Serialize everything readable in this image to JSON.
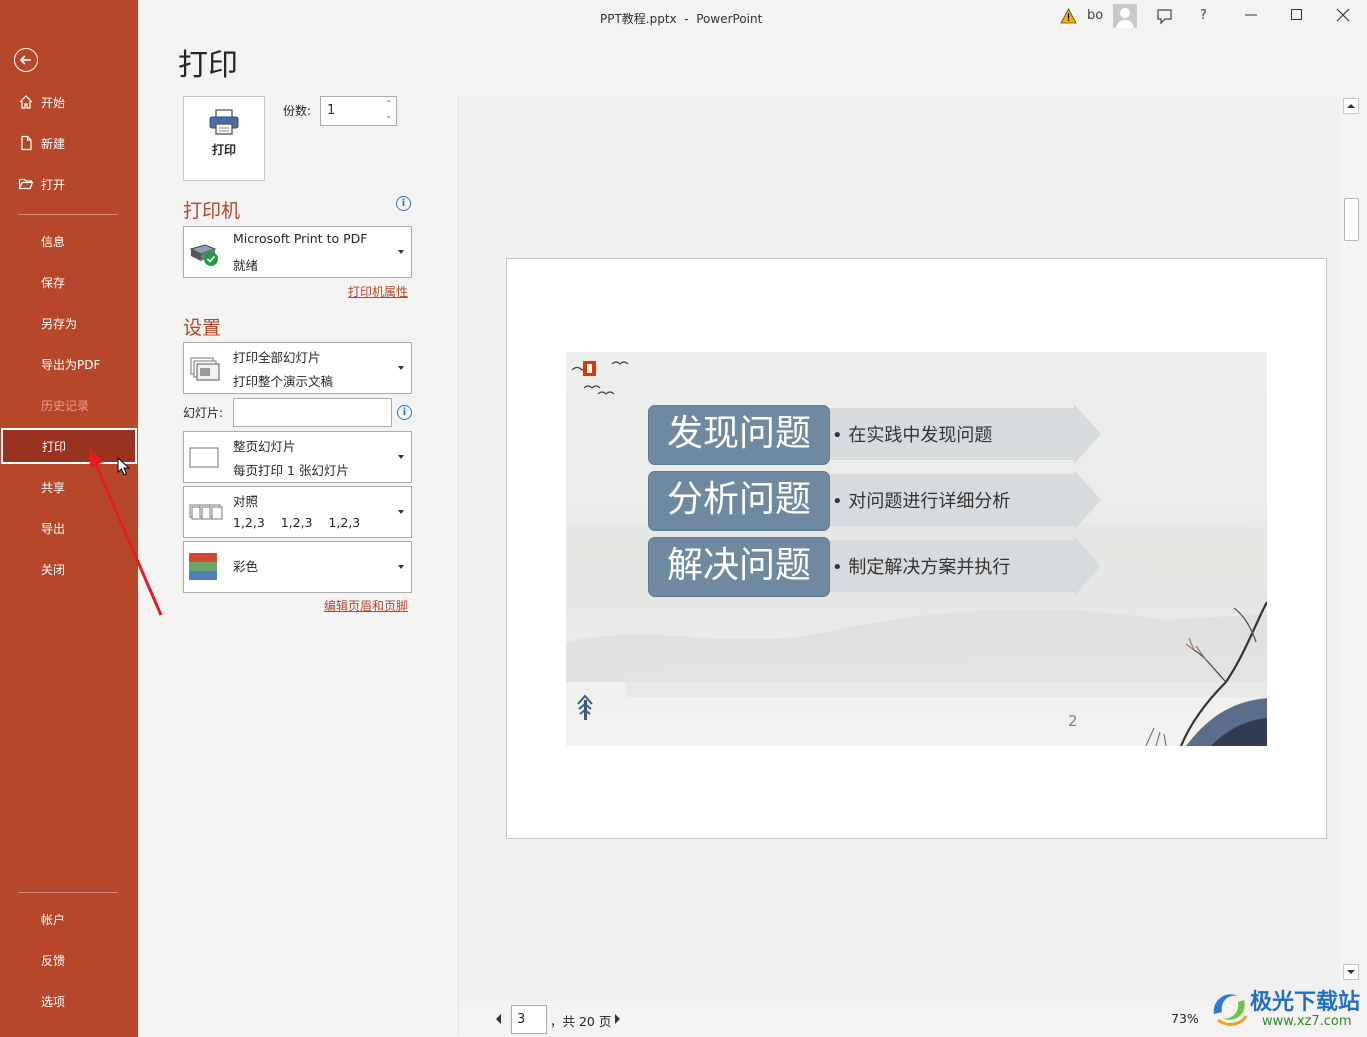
{
  "window": {
    "title": "PPT教程.pptx  -  PowerPoint",
    "user": "bo",
    "help": "?"
  },
  "sidebar": {
    "items": [
      {
        "label": "开始",
        "icon": "home-icon"
      },
      {
        "label": "新建",
        "icon": "new-file-icon"
      },
      {
        "label": "打开",
        "icon": "open-folder-icon"
      },
      {
        "label": "信息"
      },
      {
        "label": "保存"
      },
      {
        "label": "另存为"
      },
      {
        "label": "导出为PDF"
      },
      {
        "label": "历史记录"
      },
      {
        "label": "打印"
      },
      {
        "label": "共享"
      },
      {
        "label": "导出"
      },
      {
        "label": "关闭"
      }
    ],
    "bottom_items": [
      {
        "label": "帐户"
      },
      {
        "label": "反馈"
      },
      {
        "label": "选项"
      }
    ],
    "active": "打印"
  },
  "print": {
    "heading": "打印",
    "print_button": "打印",
    "copies_label": "份数:",
    "copies_value": "1",
    "printer_heading": "打印机",
    "printer": {
      "name": "Microsoft Print to PDF",
      "status": "就绪"
    },
    "printer_props_link": "打印机属性",
    "settings_heading": "设置",
    "range": {
      "title": "打印全部幻灯片",
      "subtitle": "打印整个演示文稿"
    },
    "slides_label": "幻灯片:",
    "slides_value": "",
    "layout": {
      "title": "整页幻灯片",
      "subtitle": "每页打印 1 张幻灯片"
    },
    "collate": {
      "title": "对照",
      "subtitle": "1,2,3    1,2,3    1,2,3"
    },
    "color": {
      "title": "彩色"
    },
    "header_footer_link": "编辑页眉和页脚"
  },
  "preview": {
    "current_page": "3",
    "total_pages": "，共 20 页",
    "zoom": "73%",
    "slide": {
      "rows": [
        {
          "heading": "发现问题",
          "text": "在实践中发现问题"
        },
        {
          "heading": "分析问题",
          "text": "对问题进行详细分析"
        },
        {
          "heading": "解决问题",
          "text": "制定解决方案并执行"
        }
      ],
      "bullet": "•",
      "page_number": "2"
    }
  },
  "watermark": {
    "text": "极光下载站",
    "url": "www.xz7.com"
  },
  "colors": {
    "accent": "#b7472a",
    "active": "#99331f",
    "box": "#6f8aa0"
  }
}
